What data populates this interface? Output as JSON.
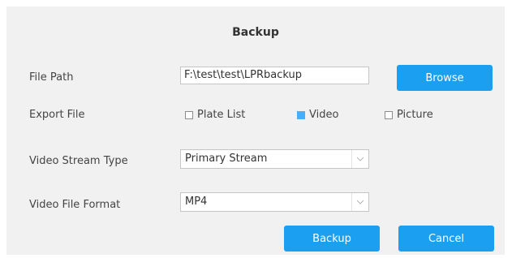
{
  "dialog": {
    "title": "Backup",
    "file_path": {
      "label": "File Path",
      "value": "F:\\test\\test\\LPRbackup",
      "browse_label": "Browse"
    },
    "export_file": {
      "label": "Export File",
      "options": [
        {
          "label": "Plate List",
          "checked": false
        },
        {
          "label": "Video",
          "checked": true
        },
        {
          "label": "Picture",
          "checked": false
        }
      ]
    },
    "video_stream_type": {
      "label": "Video Stream Type",
      "selected": "Primary Stream"
    },
    "video_file_format": {
      "label": "Video File Format",
      "selected": "MP4"
    },
    "buttons": {
      "backup_label": "Backup",
      "cancel_label": "Cancel"
    },
    "colors": {
      "accent": "#1b9ff0",
      "checked": "#49aef5",
      "panel": "#f1f1f1"
    }
  }
}
